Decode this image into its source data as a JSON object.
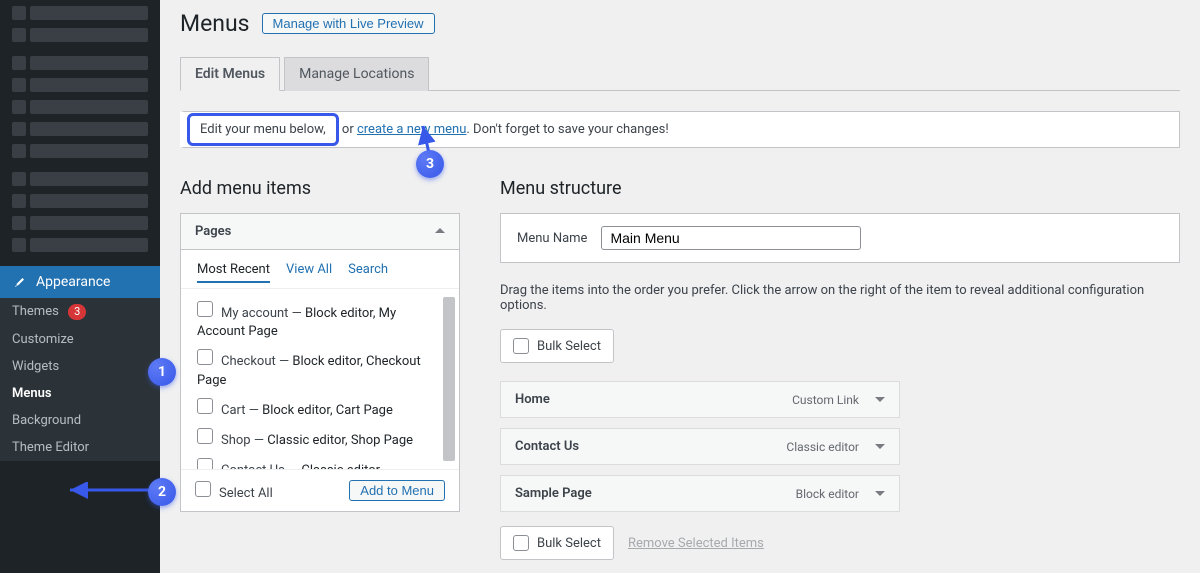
{
  "sidebar": {
    "appearance_label": "Appearance",
    "sub": [
      {
        "label": "Themes",
        "badge": "3"
      },
      {
        "label": "Customize"
      },
      {
        "label": "Widgets"
      },
      {
        "label": "Menus",
        "active": true
      },
      {
        "label": "Background"
      },
      {
        "label": "Theme Editor"
      }
    ]
  },
  "page": {
    "title": "Menus",
    "preview_button": "Manage with Live Preview",
    "tabs": [
      "Edit Menus",
      "Manage Locations"
    ],
    "help_prefix": "Edit your menu below,",
    "help_or": " or ",
    "help_link": "create a new menu",
    "help_suffix": ". Don't forget to save your changes!"
  },
  "left": {
    "title": "Add menu items",
    "accordion_title": "Pages",
    "inner_tabs": [
      "Most Recent",
      "View All",
      "Search"
    ],
    "pages": [
      {
        "name": "My account",
        "meta": "Block editor, My Account Page"
      },
      {
        "name": "Checkout",
        "meta": "Block editor, Checkout Page"
      },
      {
        "name": "Cart",
        "meta": "Block editor, Cart Page"
      },
      {
        "name": "Shop",
        "meta": "Classic editor, Shop Page"
      },
      {
        "name": "Contact Us",
        "meta": "Classic editor"
      }
    ],
    "select_all": "Select All",
    "add_button": "Add to Menu"
  },
  "right": {
    "title": "Menu structure",
    "menu_name_label": "Menu Name",
    "menu_name_value": "Main Menu",
    "instructions": "Drag the items into the order you prefer. Click the arrow on the right of the item to reveal additional configuration options.",
    "bulk_select": "Bulk Select",
    "items": [
      {
        "label": "Home",
        "type": "Custom Link"
      },
      {
        "label": "Contact Us",
        "type": "Classic editor"
      },
      {
        "label": "Sample Page",
        "type": "Block editor"
      }
    ],
    "remove_selected": "Remove Selected Items"
  },
  "markers": {
    "one": "1",
    "two": "2",
    "three": "3"
  }
}
